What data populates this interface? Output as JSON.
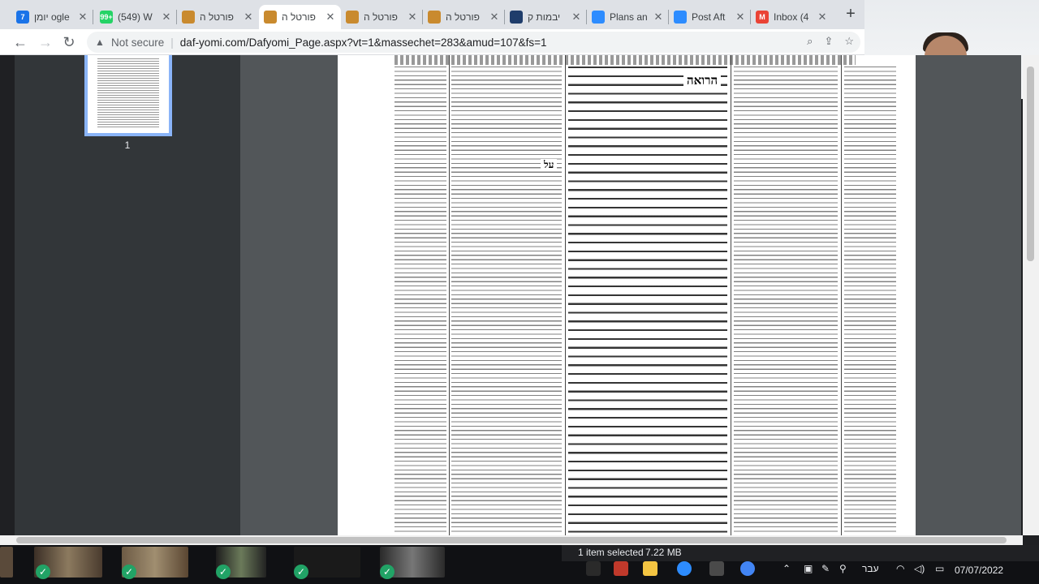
{
  "tabs": [
    {
      "title": "יומן  ogle",
      "icon": "calendar-icon",
      "color": "#1a73e8",
      "glyph": "7",
      "active": false
    },
    {
      "title": "(549) W",
      "icon": "whatsapp-icon",
      "color": "#25d366",
      "glyph": "99+",
      "active": false
    },
    {
      "title": "פורטל ה",
      "icon": "portal-icon",
      "color": "#c98a2e",
      "glyph": "",
      "active": false
    },
    {
      "title": "פורטל ה",
      "icon": "portal-icon",
      "color": "#c98a2e",
      "glyph": "",
      "active": true
    },
    {
      "title": "פורטל ה",
      "icon": "portal-icon",
      "color": "#c98a2e",
      "glyph": "",
      "active": false
    },
    {
      "title": "פורטל ה",
      "icon": "portal-icon",
      "color": "#c98a2e",
      "glyph": "",
      "active": false
    },
    {
      "title": "יבמות ק",
      "icon": "book-icon",
      "color": "#1f3d6b",
      "glyph": "",
      "active": false
    },
    {
      "title": "Plans an",
      "icon": "zoom-icon",
      "color": "#2d8cff",
      "glyph": "",
      "active": false
    },
    {
      "title": "Post Aft",
      "icon": "zoom-icon",
      "color": "#2d8cff",
      "glyph": "",
      "active": false
    },
    {
      "title": "Inbox (4",
      "icon": "gmail-icon",
      "color": "#ea4335",
      "glyph": "M",
      "active": false
    }
  ],
  "toolbar": {
    "security_label": "Not secure",
    "url": "daf-yomi.com/Dafyomi_Page.aspx?vt=1&massechet=283&amud=107&fs=1"
  },
  "pdf": {
    "page_number": "1",
    "header_word": "הרואה",
    "header_word_2": "על"
  },
  "explorer": {
    "selected": "1 item selected",
    "size": "7.22 MB"
  },
  "taskbar": {
    "lang": "עבר",
    "date": "07/07/2022"
  }
}
